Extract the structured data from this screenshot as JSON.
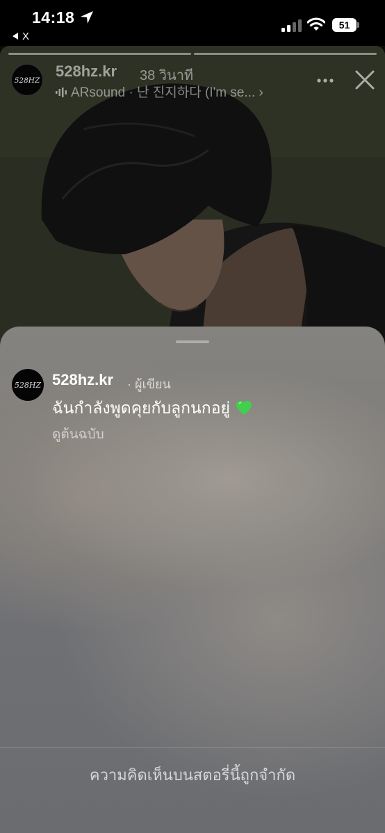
{
  "status_bar": {
    "time": "14:18",
    "back_app_label": "X",
    "battery_level": "51"
  },
  "story": {
    "username": "528hz.kr",
    "posted_ago": "38 วินาที",
    "music": "ARsound · 난 진지하다 (I'm se...",
    "progress_segments": 2,
    "avatar_logo_text": "528HZ"
  },
  "comment_sheet": {
    "author": "528hz.kr",
    "author_role": "· ผู้เขียน",
    "comment_text": "ฉันกำลังพูดคุยกับลูกนกอยู่",
    "emoji": "green-heart",
    "see_original": "ดูต้นฉบับ",
    "limited_notice": "ความคิดเห็นบนสตอรี่นี้ถูกจำกัด"
  },
  "colors": {
    "heart": "#3fd14a",
    "sheet_top": "#85837f",
    "sheet_bottom": "#6a6c70"
  }
}
